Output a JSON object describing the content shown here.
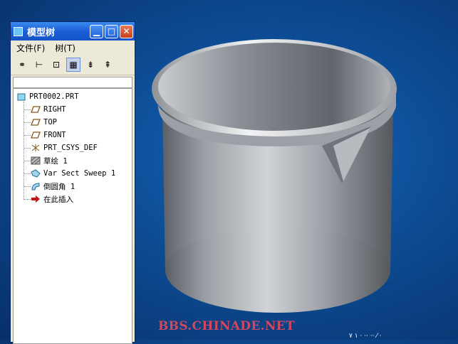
{
  "window": {
    "title": "模型树"
  },
  "menu": {
    "items": [
      "文件(F)",
      "树(T)"
    ]
  },
  "toolbar": {
    "buttons": [
      {
        "icon": "binoculars-icon",
        "glyph": "⚭"
      },
      {
        "icon": "tree-show-icon",
        "glyph": "⊢"
      },
      {
        "icon": "tree-columns-icon",
        "glyph": "⊡"
      },
      {
        "icon": "settings-filter-icon",
        "glyph": "▦"
      },
      {
        "icon": "expand-tree-icon",
        "glyph": "⇟"
      },
      {
        "icon": "collapse-tree-icon",
        "glyph": "⇞"
      }
    ]
  },
  "tree": {
    "root": "PRT0002.PRT",
    "items": [
      {
        "label": "RIGHT",
        "icon": "datum-plane-icon"
      },
      {
        "label": "TOP",
        "icon": "datum-plane-icon"
      },
      {
        "label": "FRONT",
        "icon": "datum-plane-icon"
      },
      {
        "label": "PRT_CSYS_DEF",
        "icon": "csys-icon"
      },
      {
        "label": "草绘 1",
        "icon": "sketch-icon"
      },
      {
        "label": "Var Sect Sweep 1",
        "icon": "sweep-icon"
      },
      {
        "label": "倒圆角 1",
        "icon": "round-icon"
      },
      {
        "label": "在此插入",
        "icon": "insert-here-icon"
      }
    ]
  },
  "watermark": "BBS.CHINADE.NET",
  "corner_text": "١ ٧ · ·· ·· ⁄ ·"
}
